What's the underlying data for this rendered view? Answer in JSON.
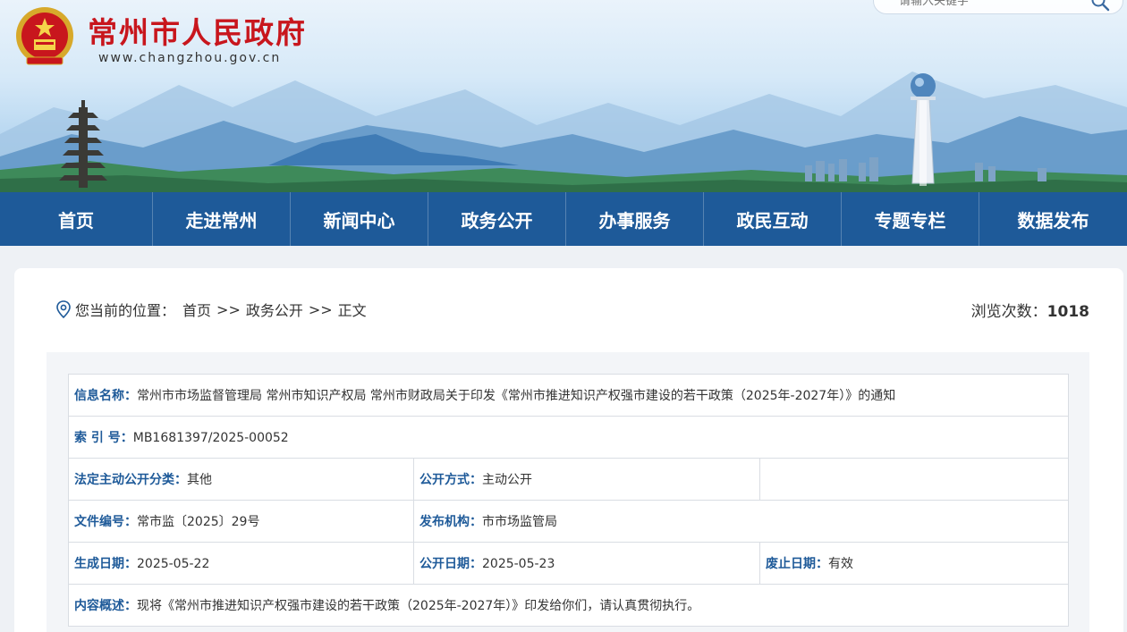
{
  "header": {
    "site_title": "常州市人民政府",
    "site_url": "www.changzhou.gov.cn",
    "search_placeholder": "请输入关键字",
    "accent_color": "#c8161d"
  },
  "nav": {
    "color": "#1e5a99",
    "items": [
      "首页",
      "走进常州",
      "新闻中心",
      "政务公开",
      "办事服务",
      "政民互动",
      "专题专栏",
      "数据发布"
    ]
  },
  "breadcrumb": {
    "prefix": "您当前的位置：",
    "items": [
      "首页",
      "政务公开",
      "正文"
    ],
    "separator": ">>"
  },
  "views": {
    "label": "浏览次数：",
    "count": "1018"
  },
  "info": {
    "title_label": "信息名称：",
    "title_value": "常州市市场监督管理局 常州市知识产权局 常州市财政局关于印发《常州市推进知识产权强市建设的若干政策（2025年-2027年）》的通知",
    "index_label": "索 引 号：",
    "index_value": "MB1681397/2025-00052",
    "category_label": "法定主动公开分类：",
    "category_value": "其他",
    "method_label": "公开方式：",
    "method_value": "主动公开",
    "docno_label": "文件编号：",
    "docno_value": "常市监〔2025〕29号",
    "org_label": "发布机构：",
    "org_value": "市市场监管局",
    "created_label": "生成日期：",
    "created_value": "2025-05-22",
    "published_label": "公开日期：",
    "published_value": "2025-05-23",
    "expiry_label": "废止日期：",
    "expiry_value": "有效",
    "summary_label": "内容概述：",
    "summary_value": "现将《常州市推进知识产权强市建设的若干政策（2025年-2027年）》印发给你们，请认真贯彻执行。"
  }
}
